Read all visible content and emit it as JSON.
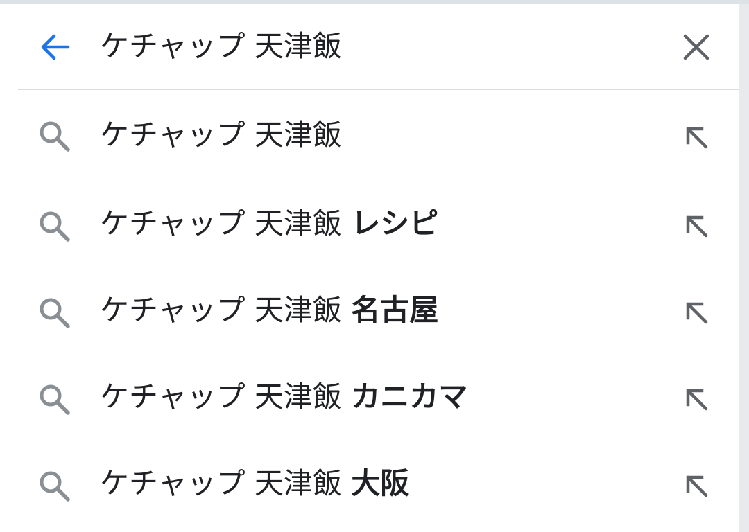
{
  "search": {
    "query": "ケチャップ 天津飯",
    "back_icon": "arrow-back-icon",
    "clear_icon": "close-icon",
    "accent_color": "#1a73e8"
  },
  "suggestions": [
    {
      "base": "ケチャップ 天津飯",
      "extra": ""
    },
    {
      "base": "ケチャップ 天津飯",
      "extra": "レシピ"
    },
    {
      "base": "ケチャップ 天津飯",
      "extra": "名古屋"
    },
    {
      "base": "ケチャップ 天津飯",
      "extra": "カニカマ"
    },
    {
      "base": "ケチャップ 天津飯",
      "extra": "大阪"
    }
  ],
  "icons": {
    "suggestion": "search-icon",
    "fill": "arrow-up-left-icon"
  }
}
